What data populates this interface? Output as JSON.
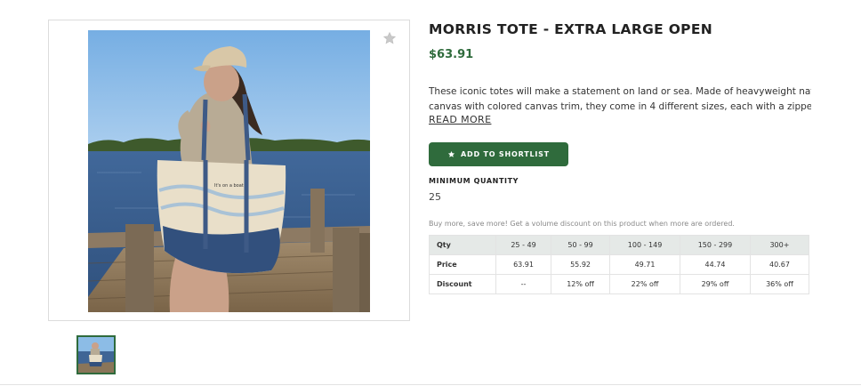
{
  "product": {
    "title": "MORRIS TOTE - EXTRA LARGE OPEN",
    "price": "$63.91",
    "description_lines": [
      "These iconic totes will make a statement on land or sea. Made of heavyweight natural",
      "canvas with colored canvas trim, they come in 4 different sizes, each with a zipper o..."
    ],
    "read_more_label": "READ MORE",
    "image_alt_text": "It's on a boat",
    "favorite_icon": "star-icon"
  },
  "shortlist": {
    "button_label": "ADD TO SHORTLIST",
    "icon": "star-icon"
  },
  "minimum_quantity": {
    "label": "MINIMUM QUANTITY",
    "value": "25"
  },
  "volume_discount": {
    "promo_text": "Buy more, save more! Get a volume discount on this product when more are ordered.",
    "header": [
      "Qty",
      "25 - 49",
      "50 - 99",
      "100 - 149",
      "150 - 299",
      "300+"
    ],
    "price_row": [
      "Price",
      "63.91",
      "55.92",
      "49.71",
      "44.74",
      "40.67"
    ],
    "discount_row": [
      "Discount",
      "--",
      "12% off",
      "22% off",
      "29% off",
      "36% off"
    ]
  },
  "colors": {
    "brand_green": "#2f6b3c",
    "table_header_bg": "#e5e9e7"
  }
}
